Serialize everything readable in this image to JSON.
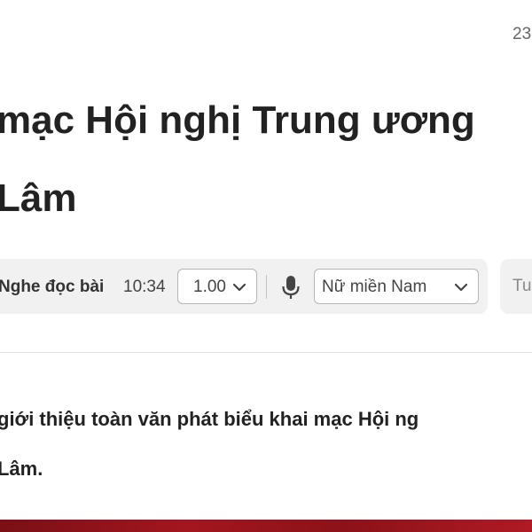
{
  "article": {
    "timestamp": "23",
    "title": "mạc Hội nghị Trung ương\nLâm",
    "lead": "giới thiệu toàn văn phát biểu khai mạc Hội ng\nLâm."
  },
  "audio_player": {
    "listen_label": "Nghe đọc bài",
    "duration": "10:34",
    "speed": {
      "selected": "1.00"
    },
    "voice": {
      "selected": "Nữ miền Nam"
    },
    "side_button_label": "Tu"
  },
  "colors": {
    "bar_background": "#f1f1f1",
    "text_primary": "#222222",
    "image_red": "#a3161f"
  },
  "icons": {
    "mic": "microphone-icon",
    "dropdown": "chevron-down-icon"
  }
}
